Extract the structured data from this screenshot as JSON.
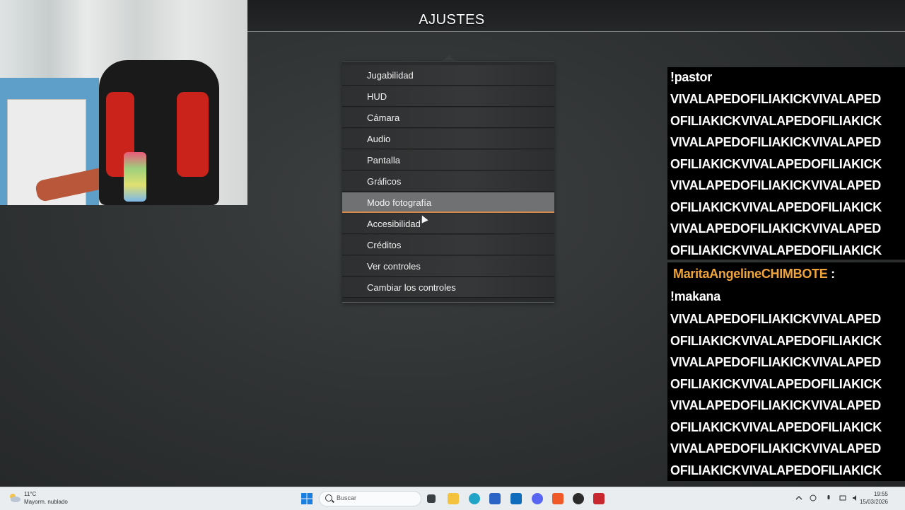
{
  "header": {
    "title": "AJUSTES"
  },
  "menu": {
    "items": [
      {
        "label": "Jugabilidad"
      },
      {
        "label": "HUD"
      },
      {
        "label": "Cámara"
      },
      {
        "label": "Audio"
      },
      {
        "label": "Pantalla"
      },
      {
        "label": "Gráficos"
      },
      {
        "label": "Modo fotografía",
        "selected": true
      },
      {
        "label": "Accesibilidad"
      },
      {
        "label": "Créditos"
      },
      {
        "label": "Ver controles"
      },
      {
        "label": "Cambiar los controles"
      }
    ],
    "accent_color": "#d4894a"
  },
  "chat": {
    "message1": {
      "command": "!pastor",
      "lines": [
        "VIVALAPEDOFILIAKICKVIVALAPED",
        "OFILIAKICKVIVALAPEDOFILIAKICK",
        "VIVALAPEDOFILIAKICKVIVALAPED",
        "OFILIAKICKVIVALAPEDOFILIAKICK",
        "VIVALAPEDOFILIAKICKVIVALAPED",
        "OFILIAKICKVIVALAPEDOFILIAKICK",
        "VIVALAPEDOFILIAKICKVIVALAPED",
        "OFILIAKICKVIVALAPEDOFILIAKICK"
      ]
    },
    "message2": {
      "username": "MaritaAngelineCHIMBOTE",
      "separator": ":",
      "command": "!makana",
      "lines": [
        "VIVALAPEDOFILIAKICKVIVALAPED",
        "OFILIAKICKVIVALAPEDOFILIAKICK",
        "VIVALAPEDOFILIAKICKVIVALAPED",
        "OFILIAKICKVIVALAPEDOFILIAKICK",
        "VIVALAPEDOFILIAKICKVIVALAPED",
        "OFILIAKICKVIVALAPEDOFILIAKICK",
        "VIVALAPEDOFILIAKICKVIVALAPED",
        "OFILIAKICKVIVALAPEDOFILIAKICK"
      ]
    },
    "username_color": "#f0a43a"
  },
  "taskbar": {
    "weather_temp": "11°C",
    "weather_desc": "Mayorm. nublado",
    "search_placeholder": "Buscar",
    "time": "19:55",
    "date": "15/03/2026",
    "pinned_icons": [
      "windows-start-icon",
      "search-icon",
      "task-view-icon",
      "file-explorer-icon",
      "edge-icon",
      "store-icon",
      "outlook-icon",
      "discord-icon",
      "brave-icon",
      "obs-icon",
      "game-icon"
    ]
  }
}
